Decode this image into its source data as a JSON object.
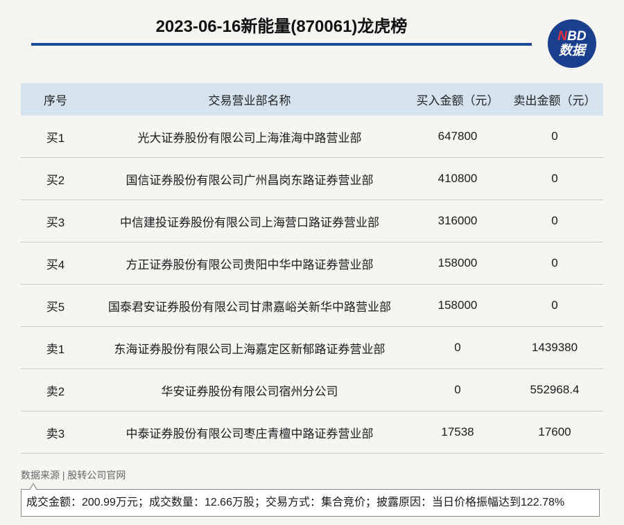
{
  "header": {
    "title": "2023-06-16新能量(870061)龙虎榜",
    "logo_line1_n": "N",
    "logo_line1_rest": "BD",
    "logo_line2": "数据"
  },
  "table": {
    "columns": [
      "序号",
      "交易营业部名称",
      "买入金额（元）",
      "卖出金额（元）"
    ],
    "rows": [
      [
        "买1",
        "光大证券股份有限公司上海淮海中路营业部",
        "647800",
        "0"
      ],
      [
        "买2",
        "国信证券股份有限公司广州昌岗东路证券营业部",
        "410800",
        "0"
      ],
      [
        "买3",
        "中信建投证券股份有限公司上海营口路证券营业部",
        "316000",
        "0"
      ],
      [
        "买4",
        "方正证券股份有限公司贵阳中华中路证券营业部",
        "158000",
        "0"
      ],
      [
        "买5",
        "国泰君安证券股份有限公司甘肃嘉峪关新华中路营业部",
        "158000",
        "0"
      ],
      [
        "卖1",
        "东海证券股份有限公司上海嘉定区新郁路证券营业部",
        "0",
        "1439380"
      ],
      [
        "卖2",
        "华安证券股份有限公司宿州分公司",
        "0",
        "552968.4"
      ],
      [
        "卖3",
        "中泰证券股份有限公司枣庄青檀中路证券营业部",
        "17538",
        "17600"
      ]
    ]
  },
  "footer": {
    "source": "数据来源 | 股转公司官网",
    "note": "成交金额：200.99万元；成交数量：12.66万股；交易方式：集合竞价；披露原因：当日价格振幅达到122.78%"
  },
  "colors": {
    "accent": "#1a4a9c",
    "header_bg": "#d5e3ef",
    "logo_bg": "#1a3f8f",
    "logo_n": "#e8343a"
  }
}
